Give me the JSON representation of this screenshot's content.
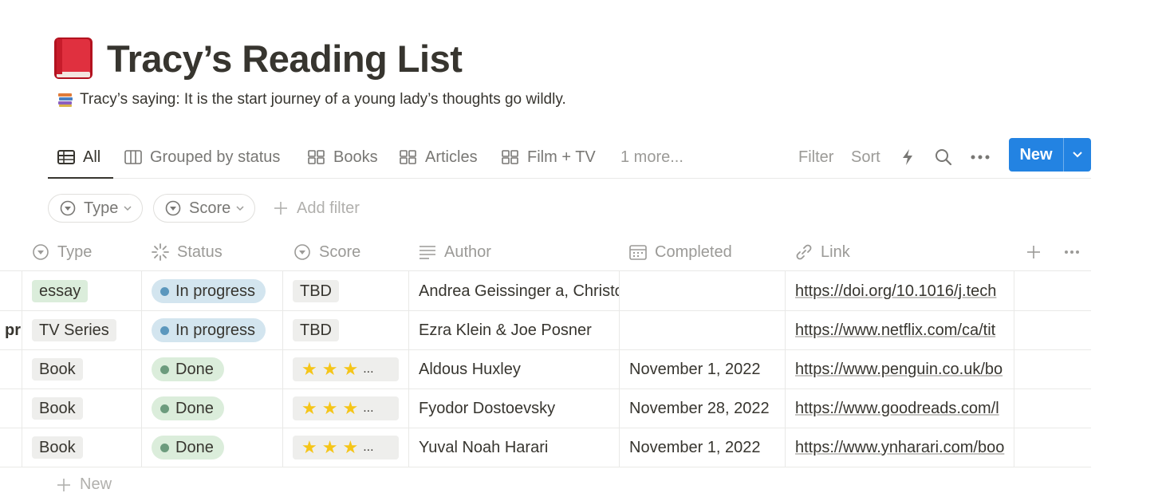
{
  "page": {
    "title": "Tracy’s Reading List",
    "title_icon": "red-book-icon",
    "subtitle": "Tracy’s saying: It is the start journey of a young lady’s thoughts go wildly.",
    "subtitle_icon": "books-stack-icon"
  },
  "views": {
    "tabs": [
      {
        "label": "All",
        "icon": "table-icon",
        "active": true
      },
      {
        "label": "Grouped by status",
        "icon": "board-icon",
        "active": false
      },
      {
        "label": "Books",
        "icon": "gallery-icon",
        "active": false
      },
      {
        "label": "Articles",
        "icon": "gallery-icon",
        "active": false
      },
      {
        "label": "Film + TV",
        "icon": "gallery-icon",
        "active": false
      }
    ],
    "more_label": "1 more...",
    "filter_label": "Filter",
    "sort_label": "Sort",
    "new_label": "New"
  },
  "filters": {
    "pills": [
      {
        "label": "Type",
        "icon": "select-icon"
      },
      {
        "label": "Score",
        "icon": "select-icon"
      }
    ],
    "add_filter_label": "Add filter"
  },
  "table": {
    "columns": [
      {
        "label": "Type",
        "icon": "select-icon"
      },
      {
        "label": "Status",
        "icon": "status-icon"
      },
      {
        "label": "Score",
        "icon": "select-icon"
      },
      {
        "label": "Author",
        "icon": "text-lines-icon"
      },
      {
        "label": "Completed",
        "icon": "calendar-icon"
      },
      {
        "label": "Link",
        "icon": "link-icon"
      }
    ],
    "rows": [
      {
        "name_fragment": "",
        "type": "essay",
        "status": "In progress",
        "score": "TBD",
        "author": "Andrea Geissinger a, Christo",
        "completed": "",
        "link": "https://doi.org/10.1016/j.tech"
      },
      {
        "name_fragment": "pr",
        "type": "TV Series",
        "status": "In progress",
        "score": "TBD",
        "author": "Ezra Klein & Joe Posner",
        "completed": "",
        "link": "https://www.netflix.com/ca/tit"
      },
      {
        "name_fragment": "",
        "type": "Book",
        "status": "Done",
        "score": "...",
        "stars": 3,
        "author": "Aldous Huxley",
        "completed": "November 1, 2022",
        "link": "https://www.penguin.co.uk/bo"
      },
      {
        "name_fragment": "",
        "type": "Book",
        "status": "Done",
        "score": "...",
        "stars": 3,
        "author": "Fyodor Dostoevsky",
        "completed": "November 28, 2022",
        "link": "https://www.goodreads.com/l"
      },
      {
        "name_fragment": "",
        "type": "Book",
        "status": "Done",
        "score": "...",
        "stars": 3,
        "author": "Yuval Noah Harari",
        "completed": "November 1, 2022",
        "link": "https://www.ynharari.com/boo"
      }
    ],
    "new_row_label": "New"
  },
  "colors": {
    "accent": "#2383e2",
    "in_progress_bg": "#d3e5ef",
    "done_bg": "#dbeddb",
    "star": "#f5c518"
  }
}
